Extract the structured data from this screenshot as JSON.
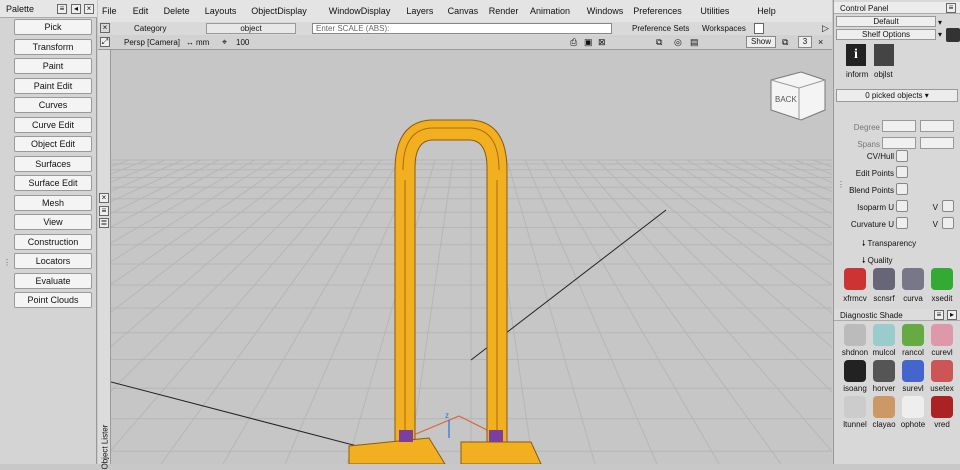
{
  "palette": {
    "title": "Palette",
    "buttons": [
      "Pick",
      "Transform",
      "Paint",
      "Paint Edit",
      "Curves",
      "Curve Edit",
      "Object Edit",
      "Surfaces",
      "Surface Edit",
      "Mesh",
      "View",
      "Construction",
      "Locators",
      "Evaluate",
      "Point Clouds"
    ]
  },
  "menubar": {
    "items": [
      "File",
      "Edit",
      "Delete",
      "Layouts",
      "ObjectDisplay",
      "WindowDisplay",
      "Layers",
      "Canvas",
      "Render",
      "Animation",
      "Windows",
      "Preferences",
      "Utilities",
      "Help"
    ]
  },
  "toolrow": {
    "category": "Category",
    "object": "object",
    "scale_placeholder": "Enter SCALE (ABS):",
    "pref_sets": "Preference Sets",
    "workspaces": "Workspaces"
  },
  "viewport": {
    "camera": "Persp [Camera]",
    "units": "mm",
    "grid": "100",
    "show": "Show",
    "count": "3",
    "cube_label": "BACK",
    "axis": "z",
    "lister": "Object Lister"
  },
  "control_panel": {
    "title": "Control Panel",
    "preset": "Default",
    "shelf_options": "Shelf Options",
    "shelf_items": [
      "inform",
      "objlst"
    ],
    "picked": "0 picked objects",
    "degree": "Degree",
    "spans": "Spans",
    "cvhull": "CV/Hull",
    "edit_points": "Edit Points",
    "blend_points": "Blend Points",
    "isoparm": "Isoparm U",
    "curvature": "Curvature U",
    "v": "V",
    "transparency": "Transparency",
    "quality": "Quality",
    "tools": [
      "xfrmcv",
      "scnsrf",
      "curva",
      "xsedit"
    ]
  },
  "diagnostic": {
    "title": "Diagnostic Shade",
    "rows": [
      [
        "shdnon",
        "mulcol",
        "rancol",
        "curevl"
      ],
      [
        "isoang",
        "horver",
        "surevl",
        "usetex"
      ],
      [
        "ltunnel",
        "clayao",
        "ophote",
        "vred"
      ]
    ]
  },
  "colors": {
    "model": "#f2b020",
    "grid": "#b9b9b9",
    "background": "#c4c4c4"
  }
}
